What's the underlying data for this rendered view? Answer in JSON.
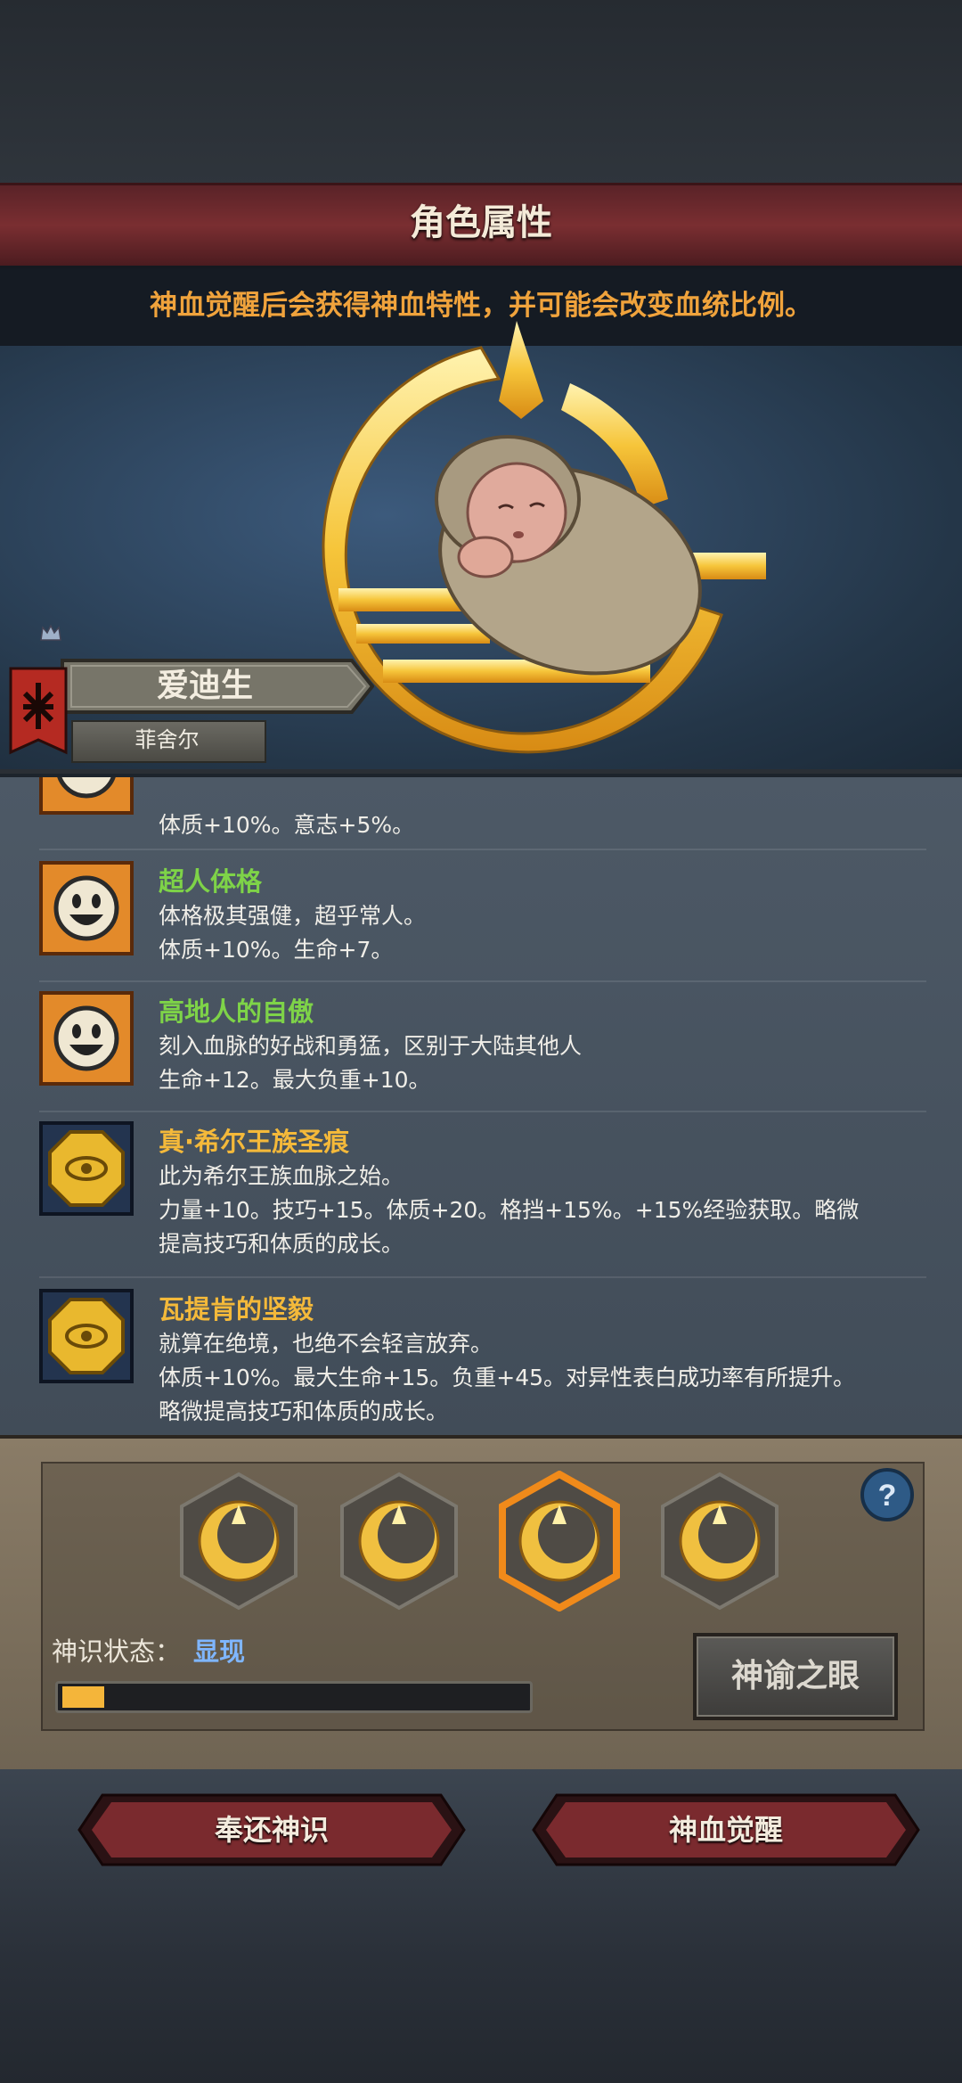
{
  "header": {
    "title": "角色属性",
    "notice": "神血觉醒后会获得神血特性，并可能会改变血统比例。"
  },
  "character": {
    "name": "爱迪生",
    "subtitle": "菲舍尔"
  },
  "traits": [
    {
      "title": "",
      "lines": [
        "体质+10%。意志+5%。"
      ],
      "icon": "smiley-icon",
      "title_color": "#7ed348"
    },
    {
      "title": "超人体格",
      "lines": [
        "体格极其强健，超乎常人。",
        "体质+10%。生命+7。"
      ],
      "icon": "smiley-icon",
      "title_color": "#7ed348"
    },
    {
      "title": "高地人的自傲",
      "lines": [
        "刻入血脉的好战和勇猛，区别于大陆其他人",
        "生命+12。最大负重+10。"
      ],
      "icon": "smiley-icon",
      "title_color": "#7ed348"
    },
    {
      "title": "真·希尔王族圣痕",
      "lines": [
        "此为希尔王族血脉之始。",
        "力量+10。技巧+15。体质+20。格挡+15%。+15%经验获取。略微",
        "提高技巧和体质的成长。"
      ],
      "icon": "golden-eye-icon",
      "title_color": "#f4b93a"
    },
    {
      "title": "瓦提肯的坚毅",
      "lines": [
        "就算在绝境，也绝不会轻言放弃。",
        "体质+10%。最大生命+15。负重+45。对异性表白成功率有所提升。",
        "略微提高技巧和体质的成长。"
      ],
      "icon": "golden-eye-icon",
      "title_color": "#f4b93a"
    }
  ],
  "divine": {
    "status_label": "神识状态：",
    "status_value": "显现",
    "progress": 0.09,
    "oracle_button": "神谕之眼",
    "selected_slot": 3
  },
  "actions": {
    "return_button": "奉还神识",
    "awaken_button": "神血觉醒"
  }
}
